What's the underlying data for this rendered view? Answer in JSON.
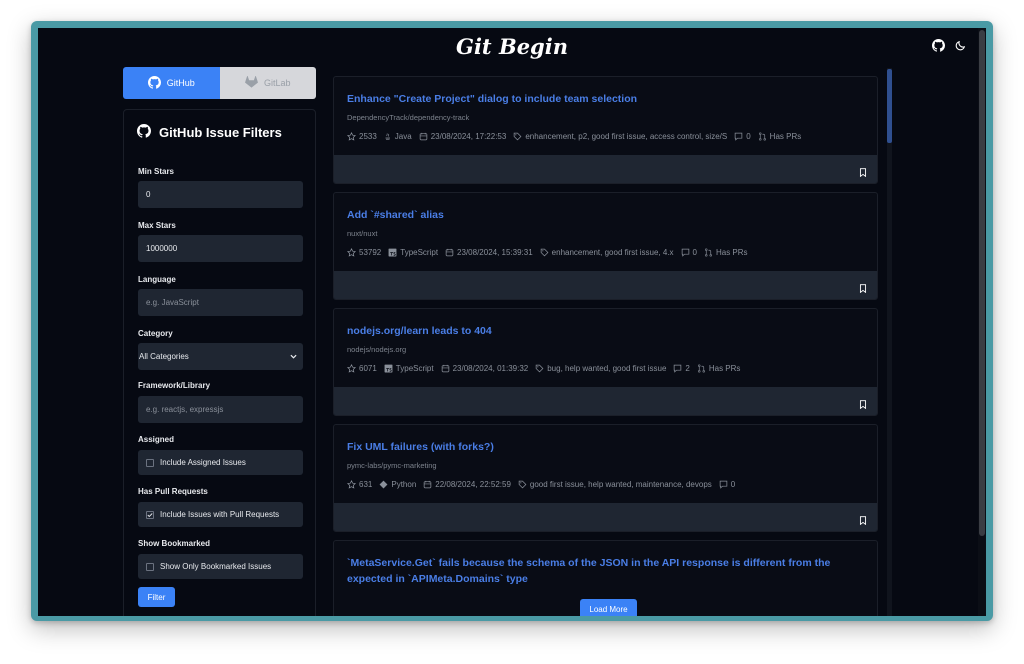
{
  "app": {
    "title": "Git Begin"
  },
  "sidebar": {
    "tabs": [
      {
        "label": "GitHub",
        "active": true
      },
      {
        "label": "GitLab",
        "active": false
      }
    ],
    "header": "GitHub Issue Filters",
    "fields": {
      "min_stars": {
        "label": "Min Stars",
        "value": "0"
      },
      "max_stars": {
        "label": "Max Stars",
        "value": "1000000"
      },
      "language": {
        "label": "Language",
        "placeholder": "e.g. JavaScript"
      },
      "category": {
        "label": "Category",
        "value": "All Categories"
      },
      "framework": {
        "label": "Framework/Library",
        "placeholder": "e.g. reactjs, expressjs"
      },
      "assigned": {
        "label": "Assigned",
        "option": "Include Assigned Issues",
        "checked": false
      },
      "pull_requests": {
        "label": "Has Pull Requests",
        "option": "Include Issues with Pull Requests",
        "checked": true
      },
      "bookmarked": {
        "label": "Show Bookmarked",
        "option": "Show Only Bookmarked Issues",
        "checked": false
      }
    },
    "filter_button": "Filter"
  },
  "issues": [
    {
      "title": "Enhance \"Create Project\" dialog to include team selection",
      "repo": "DependencyTrack/dependency-track",
      "stars": "2533",
      "language": "Java",
      "language_icon": "java-icon",
      "date": "23/08/2024, 17:22:53",
      "labels": "enhancement, p2, good first issue, access control, size/S",
      "comments": "0",
      "has_prs": "Has PRs"
    },
    {
      "title": "Add `#shared` alias",
      "repo": "nuxt/nuxt",
      "stars": "53792",
      "language": "TypeScript",
      "language_icon": "typescript-icon",
      "date": "23/08/2024, 15:39:31",
      "labels": "enhancement, good first issue, 4.x",
      "comments": "0",
      "has_prs": "Has PRs"
    },
    {
      "title": "nodejs.org/learn leads to 404",
      "repo": "nodejs/nodejs.org",
      "stars": "6071",
      "language": "TypeScript",
      "language_icon": "typescript-icon",
      "date": "23/08/2024, 01:39:32",
      "labels": "bug, help wanted, good first issue",
      "comments": "2",
      "has_prs": "Has PRs"
    },
    {
      "title": "Fix UML failures (with forks?)",
      "repo": "pymc-labs/pymc-marketing",
      "stars": "631",
      "language": "Python",
      "language_icon": "python-icon",
      "date": "22/08/2024, 22:52:59",
      "labels": "good first issue, help wanted, maintenance, devops",
      "comments": "0",
      "has_prs": ""
    },
    {
      "title": "`MetaService.Get` fails because the schema of the JSON in the API response is different from the expected in `APIMeta.Domains` type"
    }
  ],
  "load_more": "Load More",
  "colors": {
    "accent": "#3b82f6",
    "link": "#4a7ee6",
    "background": "#060912",
    "frame": "#4a9aa5"
  }
}
